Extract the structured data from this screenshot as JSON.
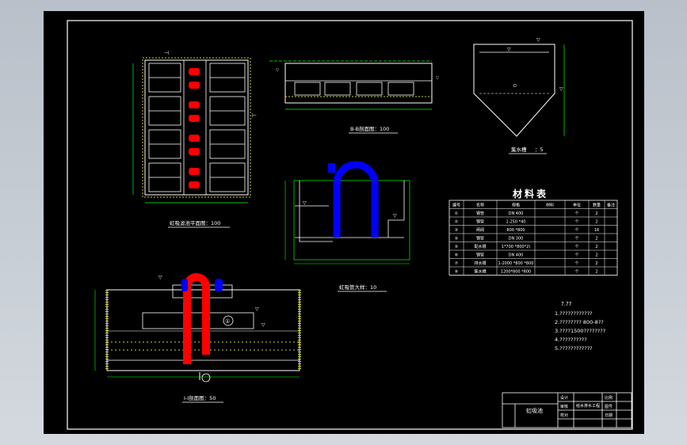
{
  "views": {
    "plan_title": "虹吸滤池平面图：100",
    "section_bb_title": "B-B剖面图：100",
    "hopper_label": "集水槽",
    "hopper_scale": "：5",
    "siphon_title": "虹吸管大样：10",
    "section_aa_title": "I-I剖面图：50",
    "circle_label": "①"
  },
  "material_table": {
    "title": "材料表",
    "headers": [
      "编号",
      "名称",
      "规格",
      "材料",
      "单位",
      "数量",
      "备注"
    ],
    "rows": [
      {
        "no": "①",
        "name": "钢管",
        "spec": "DN 400",
        "material": "",
        "unit": "个",
        "qty": "2"
      },
      {
        "no": "②",
        "name": "钢管",
        "spec": "1-250 *40",
        "material": "",
        "unit": "个",
        "qty": "2"
      },
      {
        "no": "③",
        "name": "闸阀",
        "spec": "800 *800",
        "material": "",
        "unit": "个",
        "qty": "16"
      },
      {
        "no": "④",
        "name": "钢管",
        "spec": "DN 300",
        "material": "",
        "unit": "个",
        "qty": "2"
      },
      {
        "no": "⑤",
        "name": "配水槽",
        "spec": "1*700 *800*2)",
        "material": "",
        "unit": "个",
        "qty": "2"
      },
      {
        "no": "⑥",
        "name": "钢管",
        "spec": "DN 400",
        "material": "",
        "unit": "个",
        "qty": "2"
      },
      {
        "no": "⑦",
        "name": "排水槽",
        "spec": "1-2000 *800 *800",
        "material": "",
        "unit": "个",
        "qty": "2"
      },
      {
        "no": "⑧",
        "name": "集水槽",
        "spec": "1200*800 *800",
        "material": "",
        "unit": "个",
        "qty": "2"
      }
    ]
  },
  "notes": {
    "title": "?.??",
    "lines": [
      "1.????????????",
      "2.???????? 800-8??",
      "3.????1500????????",
      "4.??????????",
      "5.????????????"
    ]
  },
  "title_block": {
    "drawing_name": "虹吸池",
    "project": "给水排水工程",
    "sheet_no": "",
    "labels": [
      "设计",
      "审核",
      "校对",
      "比例",
      "图号",
      "日期"
    ]
  },
  "colors": {
    "frame": "#ffffff",
    "background": "#000000",
    "dimension": "#00ff00",
    "hatch": "#cccc33",
    "siphon_red": "#ff0000",
    "siphon_blue": "#0000ff",
    "table_title": "#ffffff"
  }
}
